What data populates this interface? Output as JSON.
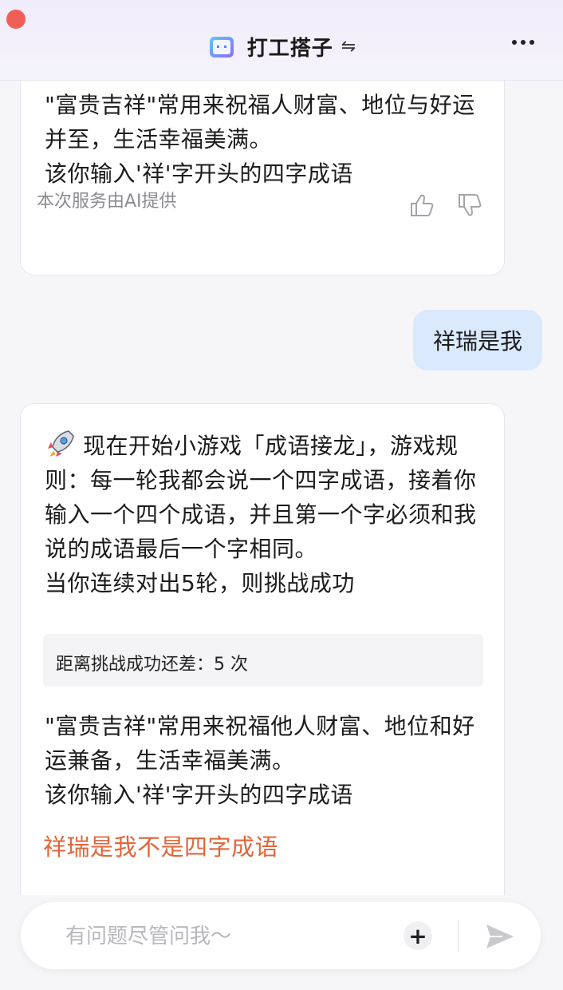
{
  "header": {
    "title": "打工搭子",
    "switch_icon": "⇋"
  },
  "messages": {
    "ai_first": {
      "text": "\"富贵吉祥\"常用来祝福人财富、地位与好运并至，生活幸福美满。\n该你输入'祥'字开头的四字成语",
      "provider": "本次服务由AI提供"
    },
    "user": {
      "text": "祥瑞是我"
    },
    "ai_second": {
      "intro": "现在开始小游戏「成语接龙」，游戏规则：每一轮我都会说一个四字成语，接着你输入一个四个成语，并且第一个字必须和我说的成语最后一个字相同。\n当你连续对出5轮，则挑战成功",
      "counter": "距离挑战成功还差：5 次",
      "explanation": "\"富贵吉祥\"常用来祝福他人财富、地位和好运兼备，生活幸福美满。\n该你输入'祥'字开头的四字成语",
      "warning": "祥瑞是我不是四字成语"
    }
  },
  "input": {
    "placeholder": "有问题尽管问我～",
    "plus_label": "+"
  },
  "colors": {
    "accent_warning": "#e0663c",
    "user_bubble": "#dbe9fd",
    "close_dot": "#ef5f57"
  },
  "icons": [
    "app-logo-icon",
    "swap-icon",
    "more-icon",
    "thumb-up-icon",
    "thumb-down-icon",
    "rocket-icon",
    "plus-icon",
    "send-icon"
  ]
}
